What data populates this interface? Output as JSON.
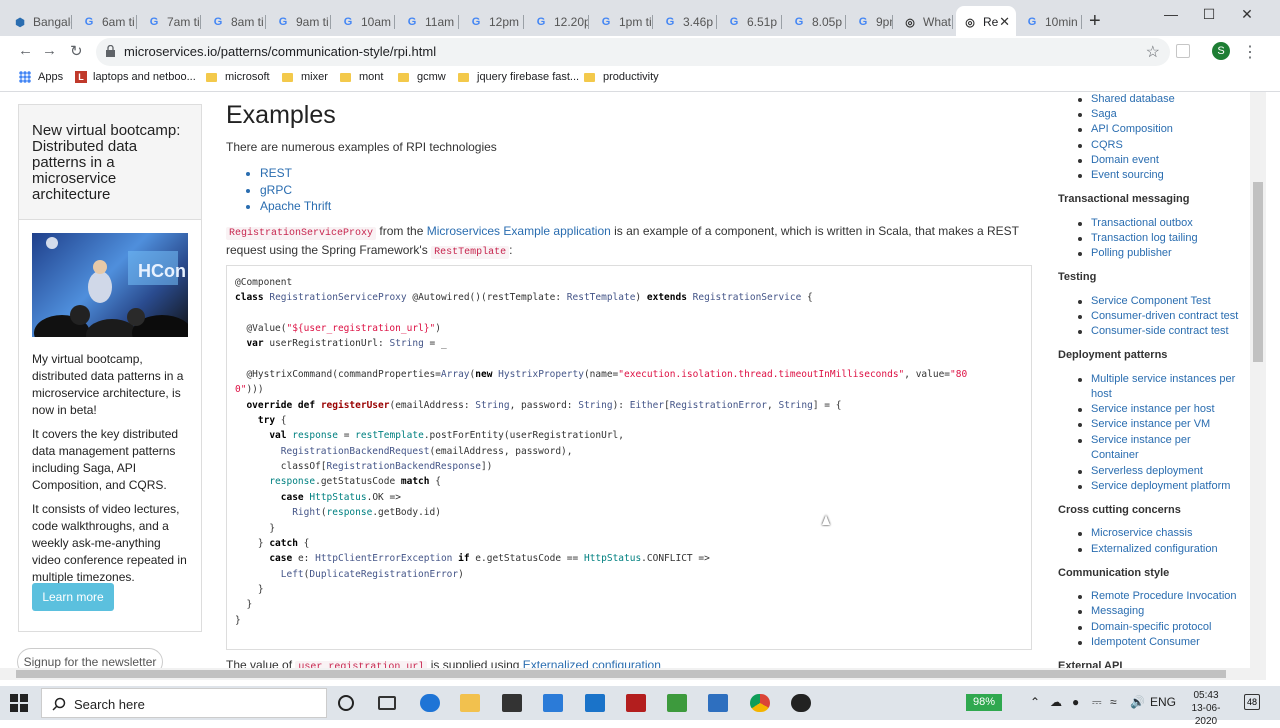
{
  "tabs": [
    {
      "label": "Bangalo",
      "icon": "bing-icon"
    },
    {
      "label": "6am ti",
      "icon": "google-icon"
    },
    {
      "label": "7am ti",
      "icon": "google-icon"
    },
    {
      "label": "8am ti",
      "icon": "google-icon"
    },
    {
      "label": "9am ti",
      "icon": "google-icon"
    },
    {
      "label": "10am",
      "icon": "google-icon"
    },
    {
      "label": "11am",
      "icon": "google-icon"
    },
    {
      "label": "12pm",
      "icon": "google-icon"
    },
    {
      "label": "12.20p",
      "icon": "google-icon"
    },
    {
      "label": "1pm ti",
      "icon": "google-icon"
    },
    {
      "label": "3.46p",
      "icon": "google-icon"
    },
    {
      "label": "6.51p",
      "icon": "google-icon"
    },
    {
      "label": "8.05p",
      "icon": "google-icon"
    },
    {
      "label": "9pm ti",
      "icon": "google-icon"
    },
    {
      "label": "What",
      "icon": "globe-icon"
    },
    {
      "label": "Re",
      "icon": "globe-icon",
      "active": true
    },
    {
      "label": "10min",
      "icon": "google-icon"
    }
  ],
  "address": {
    "url": "microservices.io/patterns/communication-style/rpi.html"
  },
  "profile_initial": "S",
  "bookmarks": [
    {
      "label": "Apps",
      "icon": "apps-grid-icon"
    },
    {
      "label": "laptops and netboo...",
      "icon": "l-red-icon"
    },
    {
      "label": "microsoft",
      "icon": "folder-icon"
    },
    {
      "label": "mixer",
      "icon": "folder-icon"
    },
    {
      "label": "mont",
      "icon": "folder-icon"
    },
    {
      "label": "gcmw",
      "icon": "folder-icon"
    },
    {
      "label": "jquery firebase fast...",
      "icon": "folder-icon"
    },
    {
      "label": "productivity",
      "icon": "folder-icon"
    }
  ],
  "promo": {
    "heading": "New virtual bootcamp: Distributed data patterns in a microservice architecture",
    "image_caption": "HCon",
    "p1": "My virtual bootcamp, distributed data patterns in a microservice architecture, is now in beta!",
    "p2": "It covers the key distributed data management patterns including Saga, API Composition, and CQRS.",
    "p3": "It consists of video lectures, code walkthroughs, and a weekly ask-me-anything video conference repeated in multiple timezones.",
    "learn_more": "Learn more",
    "signup": "Signup for the newsletter"
  },
  "main": {
    "title": "Examples",
    "intro": "There are numerous examples of RPI technologies",
    "rpi_items": [
      "REST",
      "gRPC",
      "Apache Thrift"
    ],
    "para_code1": "RegistrationServiceProxy",
    "para_t1": " from the ",
    "para_link": "Microservices Example application",
    "para_t2": " is an example of a component, which is written in Scala, that makes a REST request using the Spring Framework's ",
    "para_code2": "RestTemplate",
    "para_t3": ":",
    "bottom_t1": "The value of ",
    "bottom_code": "user_registration_url",
    "bottom_t2": " is supplied using ",
    "bottom_link": "Externalized configuration"
  },
  "rightnav": {
    "top_links": [
      "Shared database",
      "Saga",
      "API Composition",
      "CQRS",
      "Domain event",
      "Event sourcing"
    ],
    "sections": [
      {
        "title": "Transactional messaging",
        "links": [
          "Transactional outbox",
          "Transaction log tailing",
          "Polling publisher"
        ]
      },
      {
        "title": "Testing",
        "links": [
          "Service Component Test",
          "Consumer-driven contract test",
          "Consumer-side contract test"
        ]
      },
      {
        "title": "Deployment patterns",
        "links": [
          "Multiple service instances per host",
          "Service instance per host",
          "Service instance per VM",
          "Service instance per Container",
          "Serverless deployment",
          "Service deployment platform"
        ]
      },
      {
        "title": "Cross cutting concerns",
        "links": [
          "Microservice chassis",
          "Externalized configuration"
        ]
      },
      {
        "title": "Communication style",
        "links": [
          "Remote Procedure Invocation",
          "Messaging",
          "Domain-specific protocol",
          "Idempotent Consumer"
        ]
      },
      {
        "title": "External API",
        "links": []
      }
    ]
  },
  "taskbar": {
    "search_placeholder": "Search here",
    "battery": "98%",
    "lang": "ENG",
    "time": "05:43",
    "date": "13-06-2020",
    "notifications": "48"
  },
  "colors": {
    "link": "#2a6db0",
    "learn_button": "#5bc0de",
    "battery": "#2fa84f"
  }
}
